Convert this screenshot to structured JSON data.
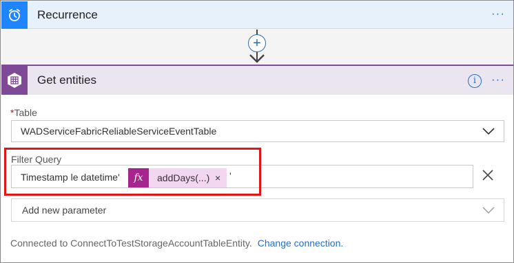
{
  "recurrence": {
    "title": "Recurrence",
    "icon": "alarm-clock-icon",
    "more_label": "···",
    "accent": "#1f85ff"
  },
  "connector": {
    "add_label": "+"
  },
  "get_entities": {
    "title": "Get entities",
    "icon": "azure-table-icon",
    "info_label": "i",
    "more_label": "···",
    "accent": "#804998",
    "table": {
      "required_mark": "*",
      "label": "Table",
      "value": "WADServiceFabricReliableServiceEventTable"
    },
    "filter_query": {
      "label": "Filter Query",
      "text_before": "Timestamp le datetime'",
      "token_fx": "fx",
      "token_label": "addDays(...)",
      "token_remove": "×",
      "text_after": "'"
    },
    "add_parameter": {
      "placeholder": "Add new parameter"
    },
    "connection": {
      "text": "Connected to ConnectToTestStorageAccountTableEntity.",
      "link": "Change connection."
    }
  },
  "highlight_color": "#e01515"
}
